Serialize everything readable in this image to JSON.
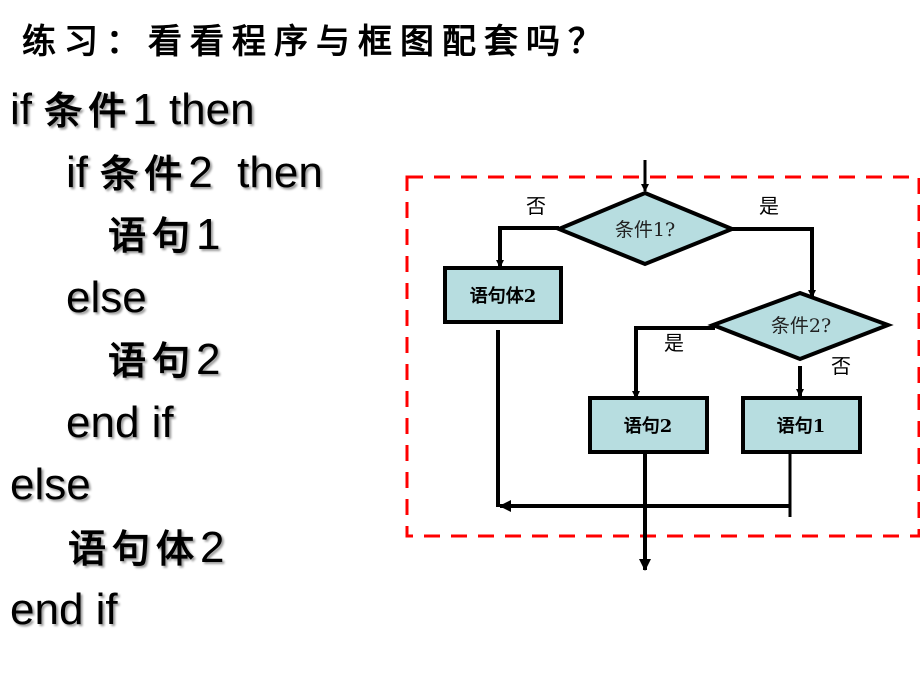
{
  "title": "练习：看看程序与框图配套吗？",
  "code": [
    {
      "indent": 0,
      "parts": [
        {
          "t": "if ",
          "cjk": false
        },
        {
          "t": "条件",
          "cjk": true
        },
        {
          "t": "1 then",
          "cjk": false
        }
      ]
    },
    {
      "indent": 1,
      "parts": [
        {
          "t": "if ",
          "cjk": false
        },
        {
          "t": "条件",
          "cjk": true
        },
        {
          "t": "2  then",
          "cjk": false
        }
      ]
    },
    {
      "indent": 2,
      "parts": [
        {
          "t": "语句",
          "cjk": true
        },
        {
          "t": "1",
          "cjk": false
        }
      ]
    },
    {
      "indent": 1,
      "parts": [
        {
          "t": "else",
          "cjk": false
        }
      ]
    },
    {
      "indent": 2,
      "parts": [
        {
          "t": "语句",
          "cjk": true
        },
        {
          "t": "2",
          "cjk": false
        }
      ]
    },
    {
      "indent": 1,
      "parts": [
        {
          "t": "end if",
          "cjk": false
        }
      ]
    },
    {
      "indent": 0,
      "parts": [
        {
          "t": "else",
          "cjk": false
        }
      ]
    },
    {
      "indent": 1,
      "parts": [
        {
          "t": "语句体",
          "cjk": true
        },
        {
          "t": "2",
          "cjk": false
        }
      ]
    },
    {
      "indent": 0,
      "parts": [
        {
          "t": "end if",
          "cjk": false
        }
      ]
    }
  ],
  "flowchart": {
    "decision1": "条件1?",
    "decision2": "条件2?",
    "box_body2": "语句体2",
    "box_stmt2": "语句2",
    "box_stmt1": "语句1",
    "label_d1_no": "否",
    "label_d1_yes": "是",
    "label_d2_yes": "是",
    "label_d2_no": "否",
    "colors": {
      "shape_fill": "#b7dde0",
      "stroke": "#000000",
      "frame": "#ff0000"
    }
  }
}
